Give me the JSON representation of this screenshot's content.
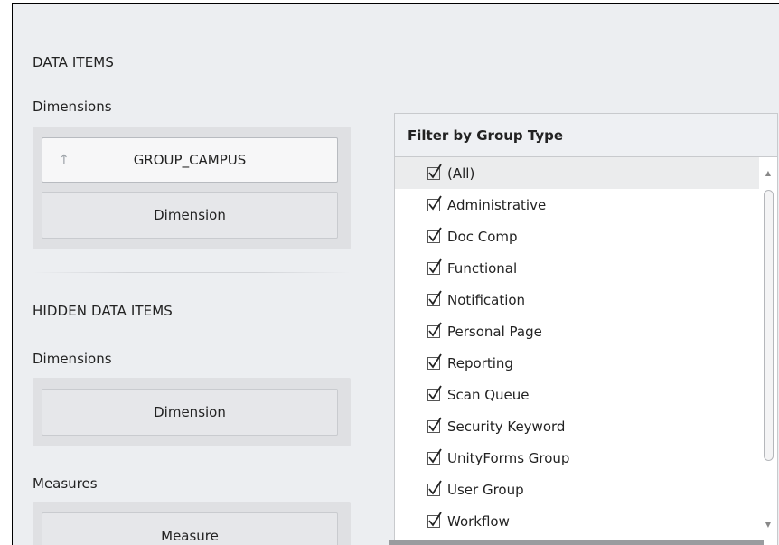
{
  "data_items": {
    "title": "DATA ITEMS",
    "dimensions_label": "Dimensions",
    "dimension_items": [
      {
        "label": "GROUP_CAMPUS",
        "sort_icon": "sort-ascending-icon"
      },
      {
        "label": "Dimension"
      }
    ]
  },
  "hidden_data_items": {
    "title": "HIDDEN DATA ITEMS",
    "dimensions_label": "Dimensions",
    "dimension_placeholder": "Dimension",
    "measures_label": "Measures",
    "measure_placeholder": "Measure"
  },
  "filter": {
    "title": "Filter by Group Type",
    "items": [
      {
        "label": "(All)",
        "checked": true
      },
      {
        "label": "Administrative",
        "checked": true
      },
      {
        "label": "Doc Comp",
        "checked": true
      },
      {
        "label": "Functional",
        "checked": true
      },
      {
        "label": "Notification",
        "checked": true
      },
      {
        "label": "Personal Page",
        "checked": true
      },
      {
        "label": "Reporting",
        "checked": true
      },
      {
        "label": "Scan Queue",
        "checked": true
      },
      {
        "label": "Security Keyword",
        "checked": true
      },
      {
        "label": "UnityForms Group",
        "checked": true
      },
      {
        "label": "User Group",
        "checked": true
      },
      {
        "label": "Workflow",
        "checked": true
      }
    ]
  },
  "icons": {
    "sort": "sort-ascending-icon",
    "checkbox": "checkbox-checked-icon",
    "scroll_up": "scroll-up-arrow-icon",
    "scroll_down": "scroll-down-arrow-icon"
  }
}
